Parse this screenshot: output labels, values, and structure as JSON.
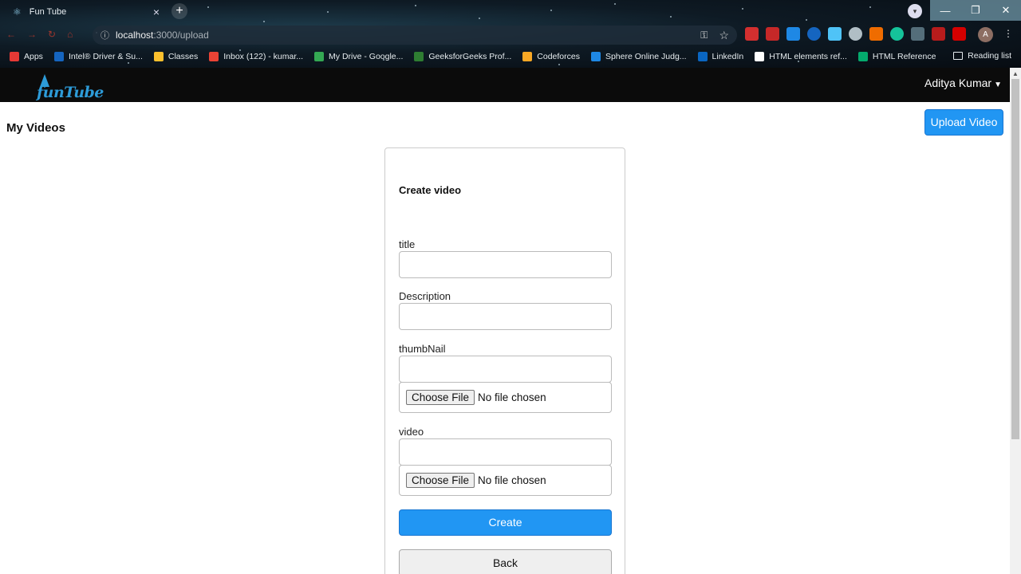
{
  "browser": {
    "tab_title": "Fun Tube",
    "tab_close": "×",
    "new_tab": "+",
    "url_host": "localhost",
    "url_path": ":3000/upload",
    "window_controls": {
      "minimize": "—",
      "maximize": "❐",
      "close": "✕"
    },
    "avatar_initial": "A",
    "bookmarks": [
      {
        "label": "Apps",
        "color": "#e53935"
      },
      {
        "label": "Intel® Driver & Su...",
        "color": "#1565c0"
      },
      {
        "label": "Classes",
        "color": "#fbc02d"
      },
      {
        "label": "Inbox (122) - kumar...",
        "color": "#ea4335"
      },
      {
        "label": "My Drive - Google...",
        "color": "#34a853"
      },
      {
        "label": "GeeksforGeeks Prof...",
        "color": "#2e7d32"
      },
      {
        "label": "Codeforces",
        "color": "#f9a825"
      },
      {
        "label": "Sphere Online Judg...",
        "color": "#1e88e5"
      },
      {
        "label": "LinkedIn",
        "color": "#0a66c2"
      },
      {
        "label": "HTML elements ref...",
        "color": "#ffffff"
      },
      {
        "label": "HTML Reference",
        "color": "#04aa6d"
      }
    ],
    "reading_list": "Reading list"
  },
  "app": {
    "logo_text": "funTube",
    "user_name": "Aditya Kumar",
    "page_title": "My Videos",
    "upload_button": "Upload Video"
  },
  "form": {
    "title": "Create video",
    "fields": {
      "title_label": "title",
      "description_label": "Description",
      "thumbnail_label": "thumbNail",
      "video_label": "video"
    },
    "file_button": "Choose File",
    "file_status": "No file chosen",
    "create_button": "Create",
    "back_button": "Back"
  }
}
